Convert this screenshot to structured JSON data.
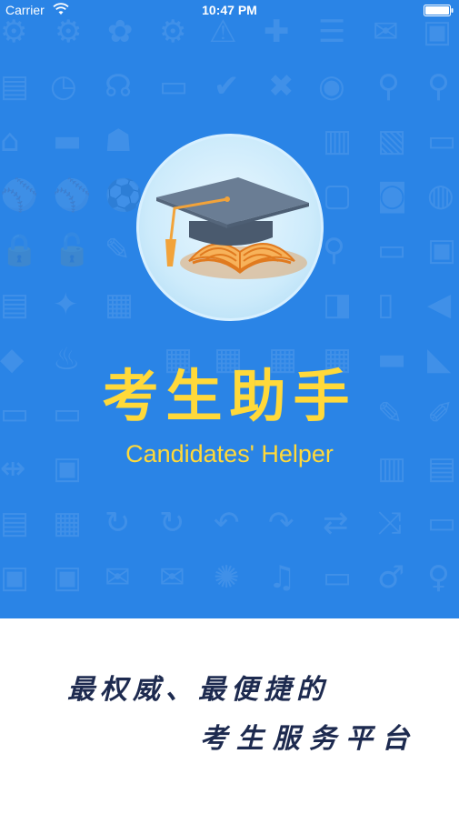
{
  "status_bar": {
    "carrier": "Carrier",
    "time": "10:47 PM"
  },
  "splash": {
    "title": "考生助手",
    "subtitle": "Candidates' Helper",
    "slogan_line1": "最权威、最便捷的",
    "slogan_line2": "考生服务平台"
  },
  "colors": {
    "background_blue": "#2a84e6",
    "title_yellow": "#ffd93a",
    "slogan_text": "#1d2a4f"
  },
  "icons": {
    "logo": "graduation-cap-book-icon",
    "background": "pattern-icons"
  }
}
